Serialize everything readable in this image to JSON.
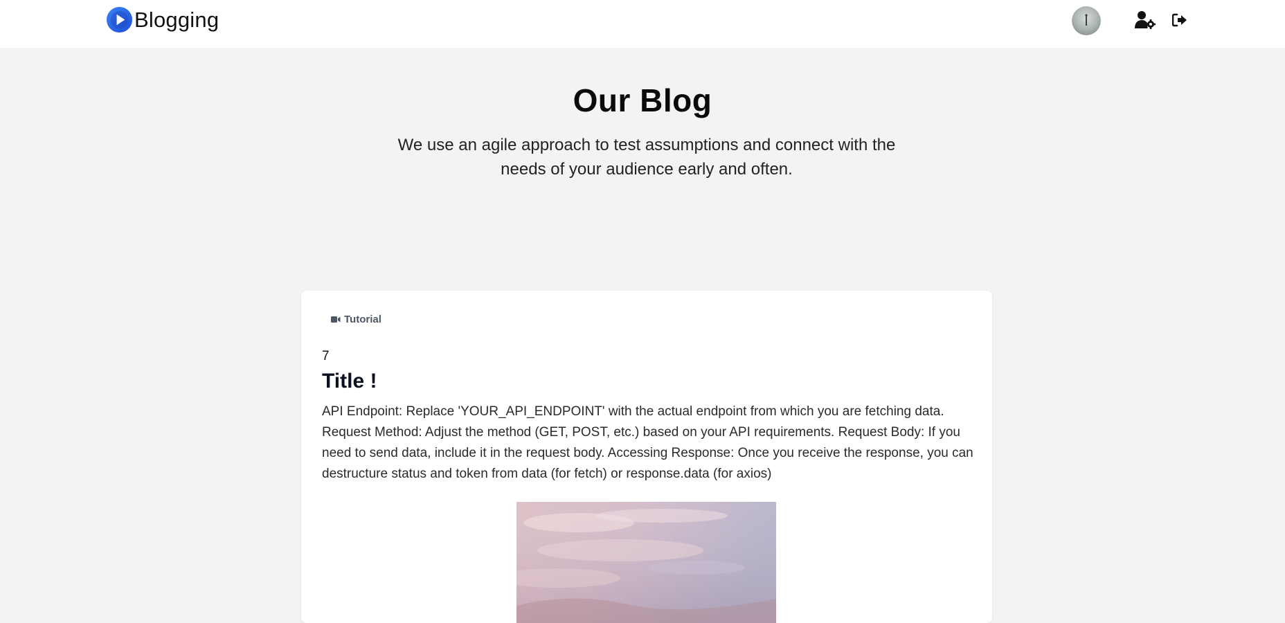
{
  "brand": {
    "name": "Blogging",
    "logo_icon": "play-circle-icon",
    "accent": "#2563eb"
  },
  "nav": {
    "avatar_icon": "user-avatar",
    "settings_icon": "user-gear-icon",
    "logout_icon": "sign-out-icon"
  },
  "hero": {
    "title": "Our Blog",
    "subtitle": "We use an agile approach to test assumptions and connect with the needs of your audience early and often."
  },
  "post": {
    "tag": "Tutorial",
    "tag_icon": "video-icon",
    "id": "7",
    "title": "Title !",
    "body": "API Endpoint: Replace 'YOUR_API_ENDPOINT' with the actual endpoint from which you are fetching data. Request Method: Adjust the method (GET, POST, etc.) based on your API requirements. Request Body: If you need to send data, include it in the request body. Accessing Response: Once you receive the response, you can destructure status and token from data (for fetch) or response.data (for axios)",
    "image_icon": "sky-photo"
  }
}
